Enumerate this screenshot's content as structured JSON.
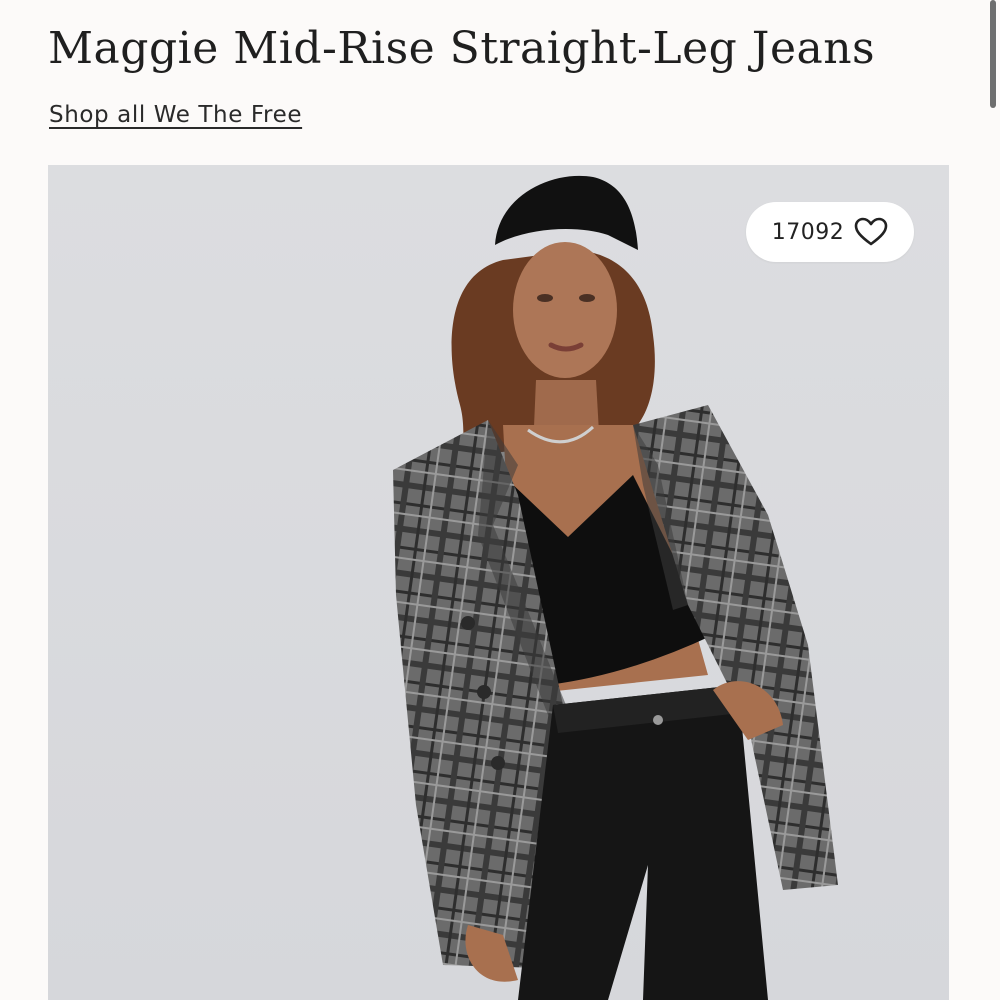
{
  "product": {
    "title": "Maggie Mid-Rise Straight-Leg Jeans",
    "brand_link": "Shop all We The Free"
  },
  "gallery": {
    "favorites_count": "17092",
    "favorite_icon": "heart-icon",
    "background_color": "#d9dadd"
  }
}
